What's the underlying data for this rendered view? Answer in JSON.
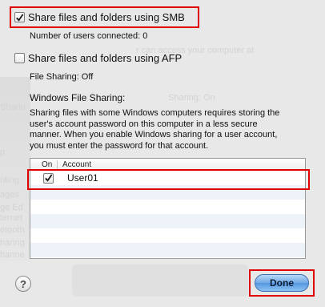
{
  "background": {
    "ghost_texts": [
      "Sharing: On",
      "r can access your computer at",
      "Sharin",
      "p",
      "ages",
      "nting",
      "ge Ed",
      "ternet",
      "etooth",
      "haring",
      "hanne"
    ]
  },
  "smb": {
    "label": "Share files and folders using SMB",
    "checked": true,
    "status": "Number of users connected: 0"
  },
  "afp": {
    "label": "Share files and folders using AFP",
    "checked": false,
    "status": "File Sharing: Off"
  },
  "windows": {
    "title": "Windows File Sharing:",
    "description": [
      "Sharing files with some Windows computers requires storing the",
      "user's account password on this computer in a less secure",
      "manner.  When you enable Windows sharing for a user account,",
      "you must enter the password for that account."
    ]
  },
  "accounts_table": {
    "columns": {
      "on": "On",
      "account": "Account"
    },
    "rows": [
      {
        "on": true,
        "account": "User01"
      }
    ]
  },
  "buttons": {
    "help": "?",
    "done": "Done"
  },
  "colors": {
    "highlight": "#e00000",
    "done_button": "#5597e0",
    "row_alt": "#eef3fa"
  },
  "icons": {
    "checkmark": "checkmark-icon",
    "help": "question-mark-icon"
  }
}
